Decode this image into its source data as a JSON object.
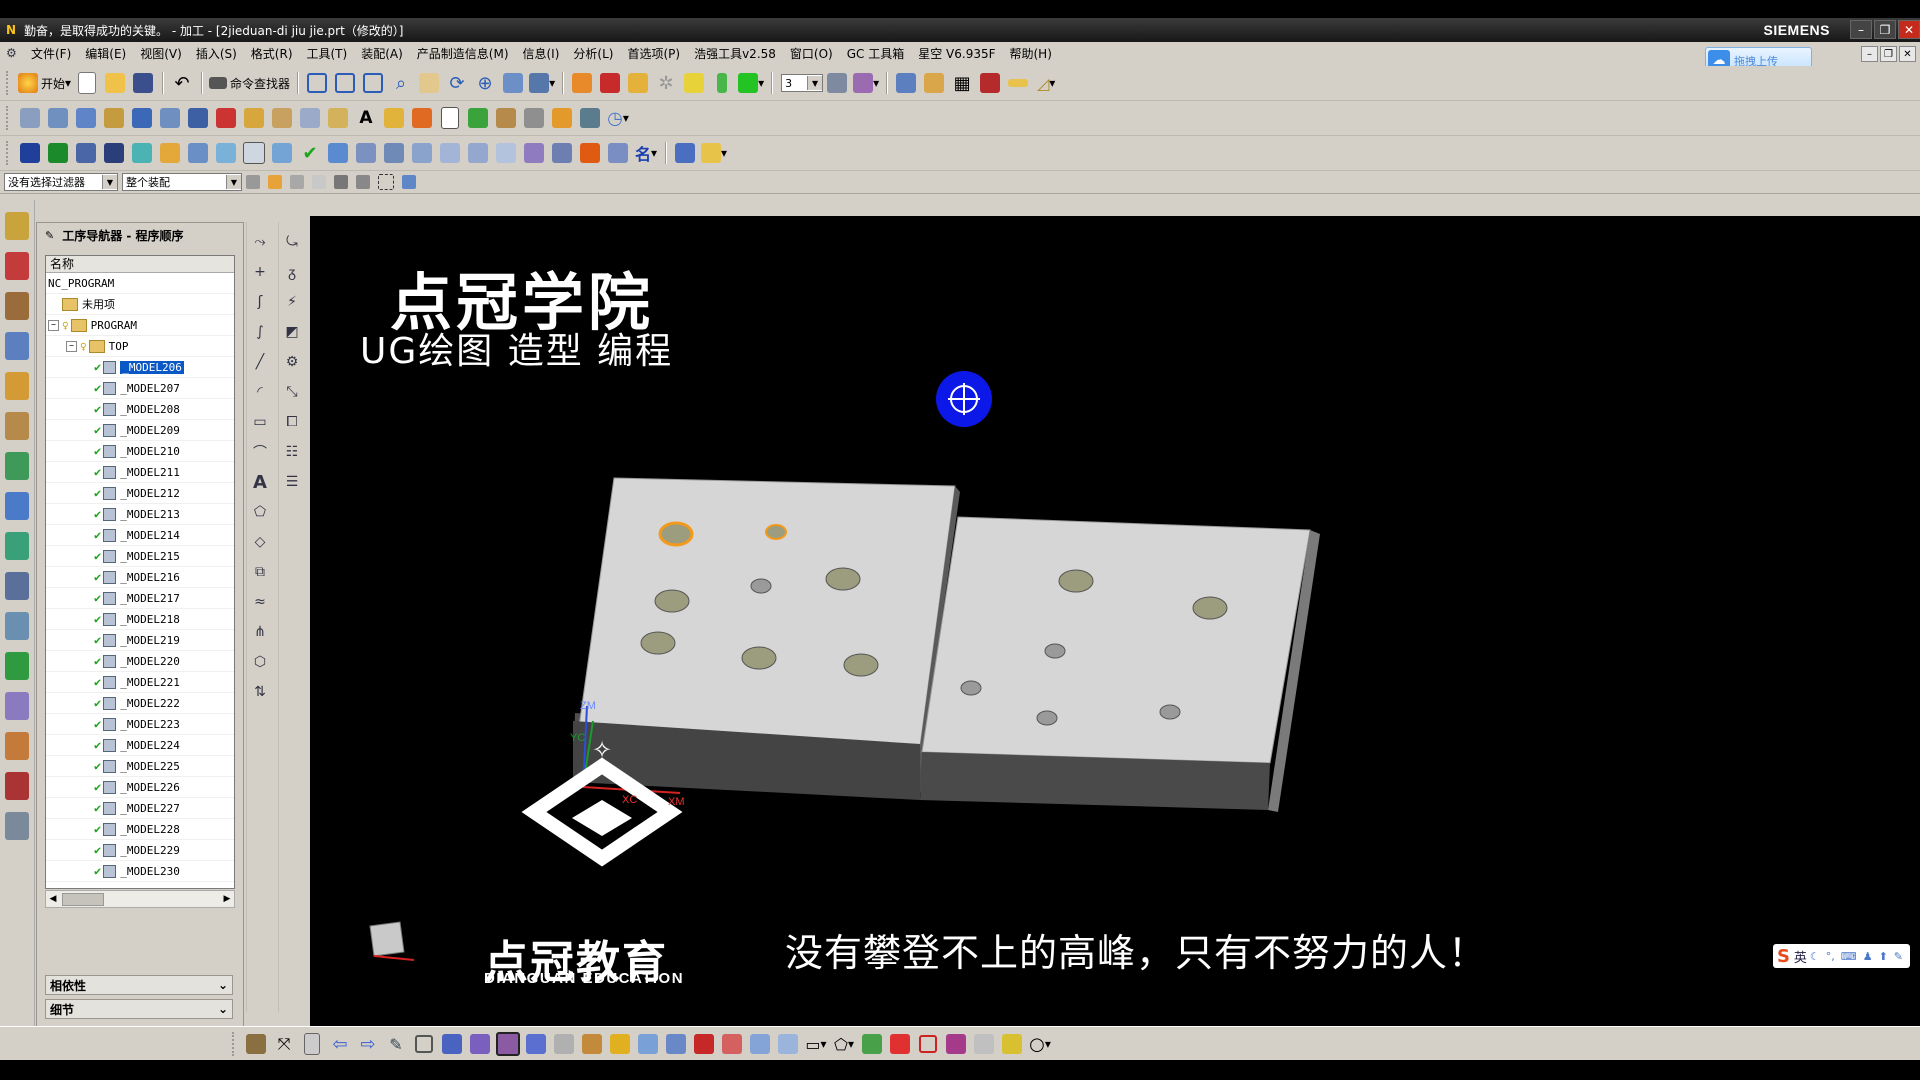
{
  "window": {
    "title": "勤奋，是取得成功的关键。 - 加工 - [2jieduan-di jiu jie.prt（修改的）]",
    "brand": "SIEMENS"
  },
  "menu": [
    "文件(F)",
    "编辑(E)",
    "视图(V)",
    "插入(S)",
    "格式(R)",
    "工具(T)",
    "装配(A)",
    "产品制造信息(M)",
    "信息(I)",
    "分析(L)",
    "首选项(P)",
    "浩强工具v2.58",
    "窗口(O)",
    "GC 工具箱",
    "星空 V6.935F",
    "帮助(H)"
  ],
  "cloud_button": {
    "label": "拖拽上传"
  },
  "toolbar": {
    "start_label": "开始",
    "command_finder_label": "命令查找器",
    "layer_value": "3"
  },
  "selection_bar": {
    "filter_value": "没有选择过滤器",
    "scope_value": "整个装配"
  },
  "navigator": {
    "title": "工序导航器 - 程序顺序",
    "column_header": "名称",
    "root": "NC_PROGRAM",
    "unused": "未用项",
    "program": "PROGRAM",
    "top": "TOP",
    "operations": [
      "_MODEL206",
      "_MODEL207",
      "_MODEL208",
      "_MODEL209",
      "_MODEL210",
      "_MODEL211",
      "_MODEL212",
      "_MODEL213",
      "_MODEL214",
      "_MODEL215",
      "_MODEL216",
      "_MODEL217",
      "_MODEL218",
      "_MODEL219",
      "_MODEL220",
      "_MODEL221",
      "_MODEL222",
      "_MODEL223",
      "_MODEL224",
      "_MODEL225",
      "_MODEL226",
      "_MODEL227",
      "_MODEL228",
      "_MODEL229",
      "_MODEL230"
    ],
    "selected_operation": "_MODEL206",
    "dependencies_label": "相依性",
    "details_label": "细节"
  },
  "viewport": {
    "watermark_title": "点冠学院",
    "watermark_subtitle": "UG绘图 造型 编程",
    "edu_name_cn": "点冠教育",
    "edu_name_en": "DIANGUAN EDUCATION",
    "slogan": "没有攀登不上的高峰，只有不努力的人！",
    "axis_zm": "ZM",
    "axis_yc": "YC",
    "axis_xc": "XC",
    "axis_xm": "XM",
    "background_color": "#000000",
    "part_top_color": "#d6d6d6",
    "hole_color": "#9c9c7e",
    "highlight_color": "#f39a1c"
  },
  "ime": {
    "mode": "英"
  }
}
